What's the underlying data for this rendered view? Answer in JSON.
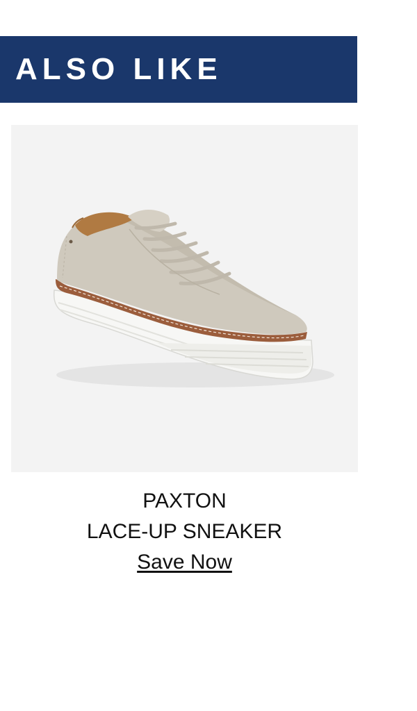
{
  "banner": {
    "title": "ALSO LIKE",
    "background_color": "#1a376b"
  },
  "product": {
    "image_icon": "sneaker-photo",
    "name": "PAXTON",
    "type": "LACE-UP SNEAKER",
    "cta_label": "Save Now"
  }
}
